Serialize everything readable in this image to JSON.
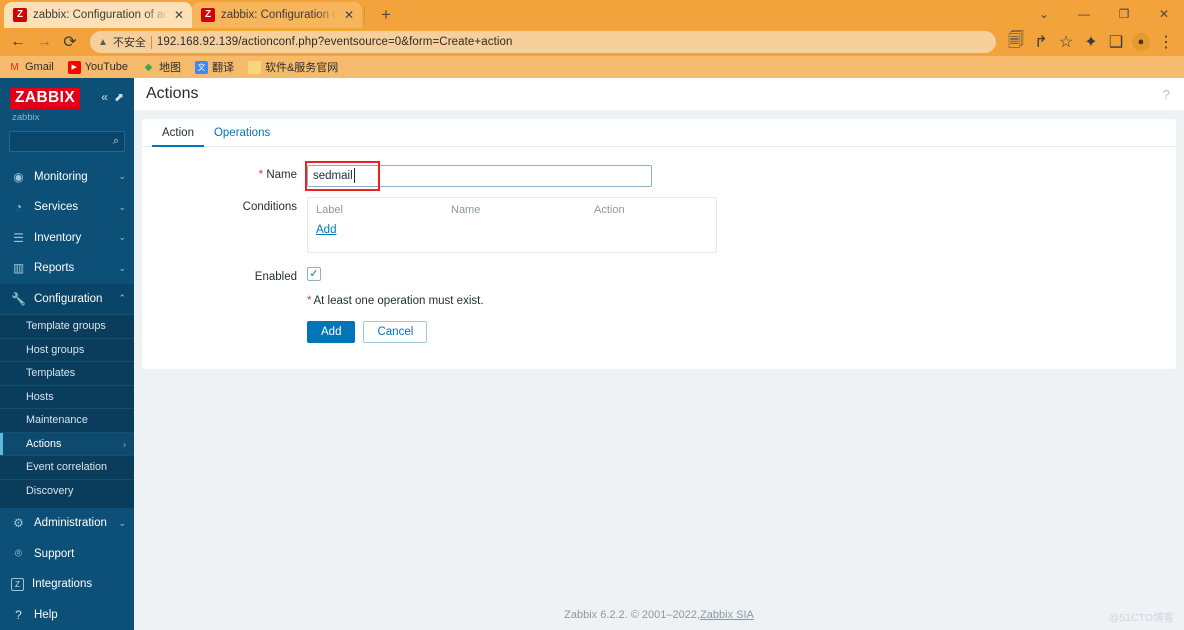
{
  "browser": {
    "tabs": [
      {
        "title": "zabbix: Configuration of action",
        "favicon": "zabbix-favicon",
        "favicon_letter": "Z",
        "active": true
      },
      {
        "title": "zabbix: Configuration of items",
        "favicon": "zabbix-favicon",
        "favicon_letter": "Z",
        "active": false
      }
    ],
    "new_tab_label": "+",
    "window_controls": {
      "tab_search": "⌄",
      "minimize": "—",
      "maximize": "❐",
      "close": "✕"
    },
    "nav": {
      "back": "←",
      "forward": "→",
      "reload": "⟳"
    },
    "omnibox": {
      "security_icon": "not-secure-warning-icon",
      "security_text": "不安全",
      "url": "192.168.92.139/actionconf.php?eventsource=0&form=Create+action"
    },
    "toolbar_right": {
      "translate": "translate-icon",
      "share": "share-icon",
      "bookmark": "star-icon",
      "extensions": "puzzle-icon",
      "side_panel": "side-panel-icon",
      "profile": "profile-avatar",
      "menu": "three-dot-menu-icon"
    },
    "bookmarks": [
      {
        "label": "Gmail",
        "icon": "gmail-icon",
        "glyph": "M",
        "color": "#d93025",
        "bg": "transparent"
      },
      {
        "label": "YouTube",
        "icon": "youtube-icon",
        "glyph": "▶",
        "color": "#ffffff",
        "bg": "#ff0000"
      },
      {
        "label": "地图",
        "icon": "maps-icon",
        "glyph": "◆",
        "color": "#34a853",
        "bg": "transparent"
      },
      {
        "label": "翻译",
        "icon": "translate-bookmark-icon",
        "glyph": "文",
        "color": "#ffffff",
        "bg": "#4285f4"
      },
      {
        "label": "软件&服务官网",
        "icon": "folder-icon",
        "glyph": "▯",
        "color": "#f0b429",
        "bg": "transparent"
      }
    ]
  },
  "sidebar": {
    "logo_text": "ZABBIX",
    "logo_color": "#e1001a",
    "collapse_icon": "double-chevron-left-icon",
    "hide_icon": "collapse-sidebar-icon",
    "username": "zabbix",
    "search_placeholder": "",
    "search_value": "",
    "search_icon": "search-icon",
    "items": [
      {
        "label": "Monitoring",
        "icon": "eye-icon",
        "glyph": "◉",
        "chevron": "⌄",
        "expanded": false
      },
      {
        "label": "Services",
        "icon": "stopwatch-icon",
        "glyph": "◔",
        "chevron": "⌄",
        "expanded": false
      },
      {
        "label": "Inventory",
        "icon": "list-icon",
        "glyph": "☰",
        "chevron": "⌄",
        "expanded": false
      },
      {
        "label": "Reports",
        "icon": "bar-chart-icon",
        "glyph": "▥",
        "chevron": "⌄",
        "expanded": false
      },
      {
        "label": "Configuration",
        "icon": "wrench-icon",
        "glyph": "🔧",
        "chevron": "⌃",
        "expanded": true
      }
    ],
    "submenu": [
      {
        "label": "Template groups",
        "active": false,
        "chevron": ""
      },
      {
        "label": "Host groups",
        "active": false,
        "chevron": ""
      },
      {
        "label": "Templates",
        "active": false,
        "chevron": ""
      },
      {
        "label": "Hosts",
        "active": false,
        "chevron": ""
      },
      {
        "label": "Maintenance",
        "active": false,
        "chevron": ""
      },
      {
        "label": "Actions",
        "active": true,
        "chevron": "›"
      },
      {
        "label": "Event correlation",
        "active": false,
        "chevron": ""
      },
      {
        "label": "Discovery",
        "active": false,
        "chevron": ""
      }
    ],
    "administration": {
      "label": "Administration",
      "icon": "gear-icon",
      "glyph": "⚙",
      "chevron": "⌄"
    },
    "bottom_items": [
      {
        "label": "Support",
        "icon": "headset-icon",
        "glyph": "⌾"
      },
      {
        "label": "Integrations",
        "icon": "zabbix-square-icon",
        "glyph": "Z"
      },
      {
        "label": "Help",
        "icon": "question-icon",
        "glyph": "?"
      }
    ]
  },
  "header": {
    "title": "Actions",
    "help_icon": "question-mark-icon",
    "help_glyph": "?"
  },
  "form": {
    "tabs": [
      {
        "label": "Action",
        "active": true
      },
      {
        "label": "Operations",
        "active": false
      }
    ],
    "name": {
      "label": "Name",
      "required_marker": "*",
      "value": "sedmail",
      "placeholder": "",
      "highlighted": true,
      "highlight_color": "#ef2020"
    },
    "conditions": {
      "label": "Conditions",
      "columns": [
        "Label",
        "Name",
        "Action"
      ],
      "rows": [],
      "add_link": "Add"
    },
    "enabled": {
      "label": "Enabled",
      "checked": true,
      "check_glyph": "✓"
    },
    "hint": {
      "marker": "*",
      "text": "At least one operation must exist."
    },
    "buttons": {
      "submit": "Add",
      "cancel": "Cancel",
      "accent_color": "#0275b8"
    }
  },
  "footer": {
    "text": "Zabbix 6.2.2. © 2001–2022, ",
    "link": "Zabbix SIA",
    "watermark": "@51CTO博客"
  }
}
